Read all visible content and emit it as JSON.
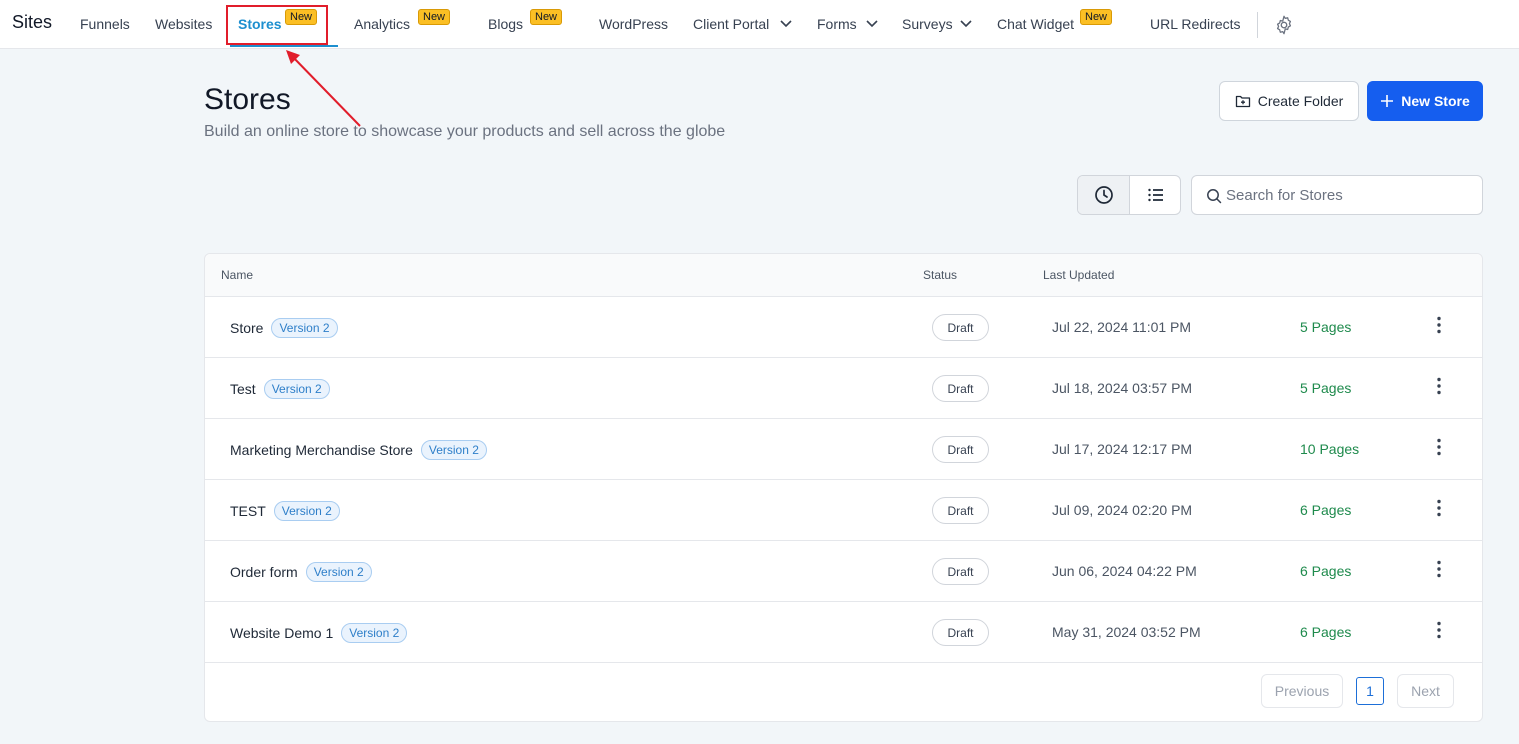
{
  "nav": {
    "brand": "Sites",
    "items": [
      {
        "label": "Funnels"
      },
      {
        "label": "Websites"
      },
      {
        "label": "Stores",
        "badge": "New"
      },
      {
        "label": "Analytics",
        "badge": "New"
      },
      {
        "label": "Blogs",
        "badge": "New"
      },
      {
        "label": "WordPress"
      },
      {
        "label": "Client Portal"
      },
      {
        "label": "Forms"
      },
      {
        "label": "Surveys"
      },
      {
        "label": "Chat Widget",
        "badge": "New"
      },
      {
        "label": "URL Redirects"
      }
    ],
    "icons": [
      "chevron-down-icon",
      "gear-icon"
    ]
  },
  "header": {
    "title": "Stores",
    "subtitle": "Build an online store to showcase your products and sell across the globe",
    "create_folder_label": "Create Folder",
    "new_store_label": "New Store"
  },
  "search": {
    "placeholder": "Search for Stores"
  },
  "table": {
    "columns": {
      "name": "Name",
      "status": "Status",
      "updated": "Last Updated"
    },
    "rows": [
      {
        "name": "Store",
        "version": "Version 2",
        "status": "Draft",
        "updated": "Jul 22, 2024 11:01 PM",
        "pages": "5 Pages"
      },
      {
        "name": "Test",
        "version": "Version 2",
        "status": "Draft",
        "updated": "Jul 18, 2024 03:57 PM",
        "pages": "5 Pages"
      },
      {
        "name": "Marketing Merchandise Store",
        "version": "Version 2",
        "status": "Draft",
        "updated": "Jul 17, 2024 12:17 PM",
        "pages": "10 Pages"
      },
      {
        "name": "TEST",
        "version": "Version 2",
        "status": "Draft",
        "updated": "Jul 09, 2024 02:20 PM",
        "pages": "6 Pages"
      },
      {
        "name": "Order form",
        "version": "Version 2",
        "status": "Draft",
        "updated": "Jun 06, 2024 04:22 PM",
        "pages": "6 Pages"
      },
      {
        "name": "Website Demo 1",
        "version": "Version 2",
        "status": "Draft",
        "updated": "May 31, 2024 03:52 PM",
        "pages": "6 Pages"
      }
    ]
  },
  "pagination": {
    "previous": "Previous",
    "current": "1",
    "next": "Next"
  },
  "colors": {
    "accent": "#1d8fcf",
    "primary_button": "#155eef",
    "badge": "#fbbf24",
    "pages_link": "#1e8a4c",
    "annotation": "#e11d2b"
  }
}
